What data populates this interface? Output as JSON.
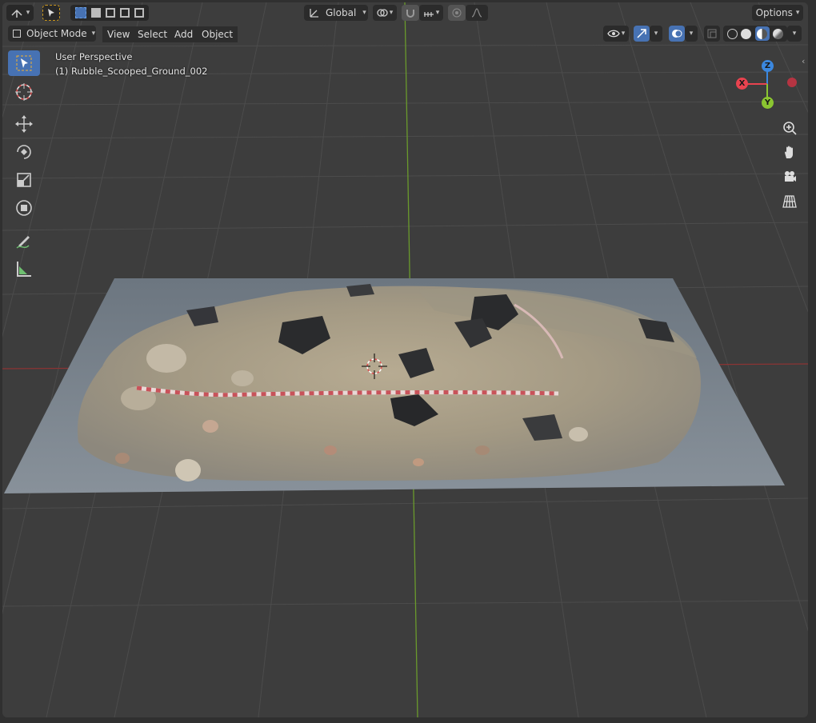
{
  "header": {
    "transform_orientation": "Global",
    "options_label": "Options"
  },
  "menubar": {
    "mode": "Object Mode",
    "items": [
      "View",
      "Select",
      "Add",
      "Object"
    ]
  },
  "viewport": {
    "view_name": "User Perspective",
    "active_object": "(1) Rubble_Scooped_Ground_002"
  },
  "gizmo": {
    "z_label": "Z",
    "x_label": "X",
    "y_label": "Y",
    "colors": {
      "x": "#e8434f",
      "y": "#8bc631",
      "z": "#3b88e0",
      "neg_x": "#b53442"
    }
  },
  "tools": [
    {
      "name": "select-box-tool",
      "icon": "select-box-icon"
    },
    {
      "name": "cursor-tool",
      "icon": "cursor-icon"
    },
    {
      "name": "move-tool",
      "icon": "move-icon"
    },
    {
      "name": "rotate-tool",
      "icon": "rotate-icon"
    },
    {
      "name": "scale-tool",
      "icon": "scale-icon"
    },
    {
      "name": "transform-tool",
      "icon": "transform-icon"
    },
    {
      "name": "annotate-tool",
      "icon": "annotate-icon"
    },
    {
      "name": "measure-tool",
      "icon": "measure-icon"
    }
  ],
  "navigation": [
    "zoom-icon",
    "hand-icon",
    "camera-icon",
    "grid-icon"
  ],
  "colors": {
    "accent": "#4772b3",
    "background": "#3d3d3d",
    "x_axis": "#9a3a3a",
    "y_axis": "#6e9a2e"
  }
}
